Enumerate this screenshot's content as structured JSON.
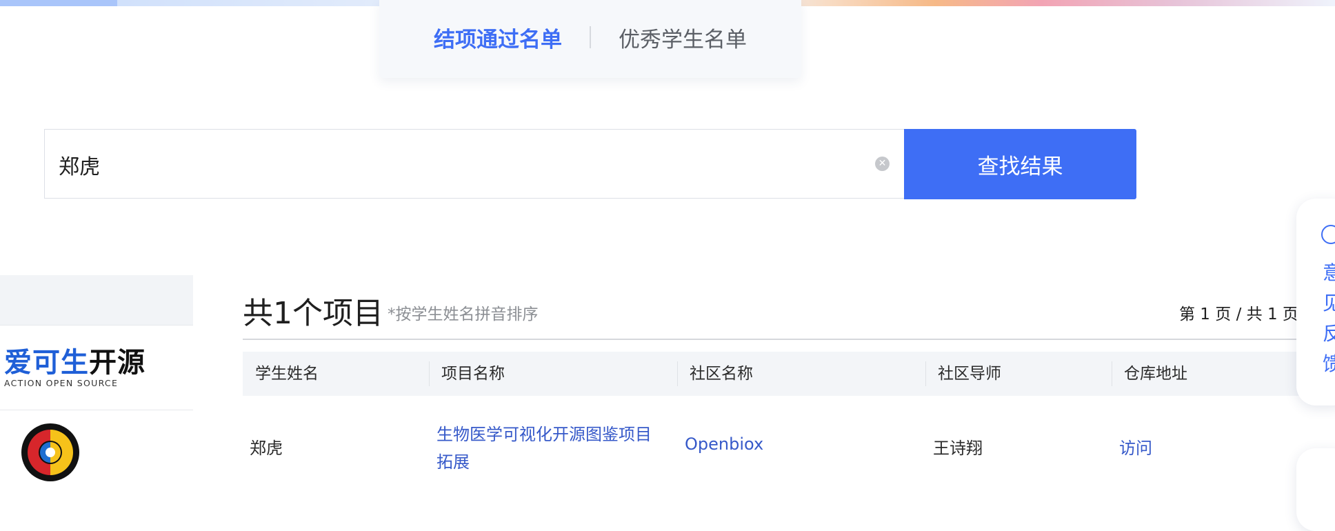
{
  "tabs": {
    "active_label": "结项通过名单",
    "inactive_label": "优秀学生名单"
  },
  "search": {
    "value": "郑虎",
    "button_label": "查找结果"
  },
  "sidebar": {
    "logo_main_blue": "爱可生",
    "logo_main_dark": "开源",
    "logo_sub": "ACTION OPEN SOURCE"
  },
  "results": {
    "count_text": "共1个项目",
    "sort_note": "*按学生姓名拼音排序",
    "pager": "第 1 页 / 共 1 页"
  },
  "table": {
    "columns": [
      "学生姓名",
      "项目名称",
      "社区名称",
      "社区导师",
      "仓库地址"
    ],
    "rows": [
      {
        "student": "郑虎",
        "project": "生物医学可视化开源图鉴项目拓展",
        "community": "Openbiox",
        "mentor": "王诗翔",
        "repo": "访问"
      }
    ]
  },
  "feedback": {
    "label": "意见反馈"
  },
  "colors": {
    "accent": "#3e6ef5",
    "link": "#3659c9"
  }
}
